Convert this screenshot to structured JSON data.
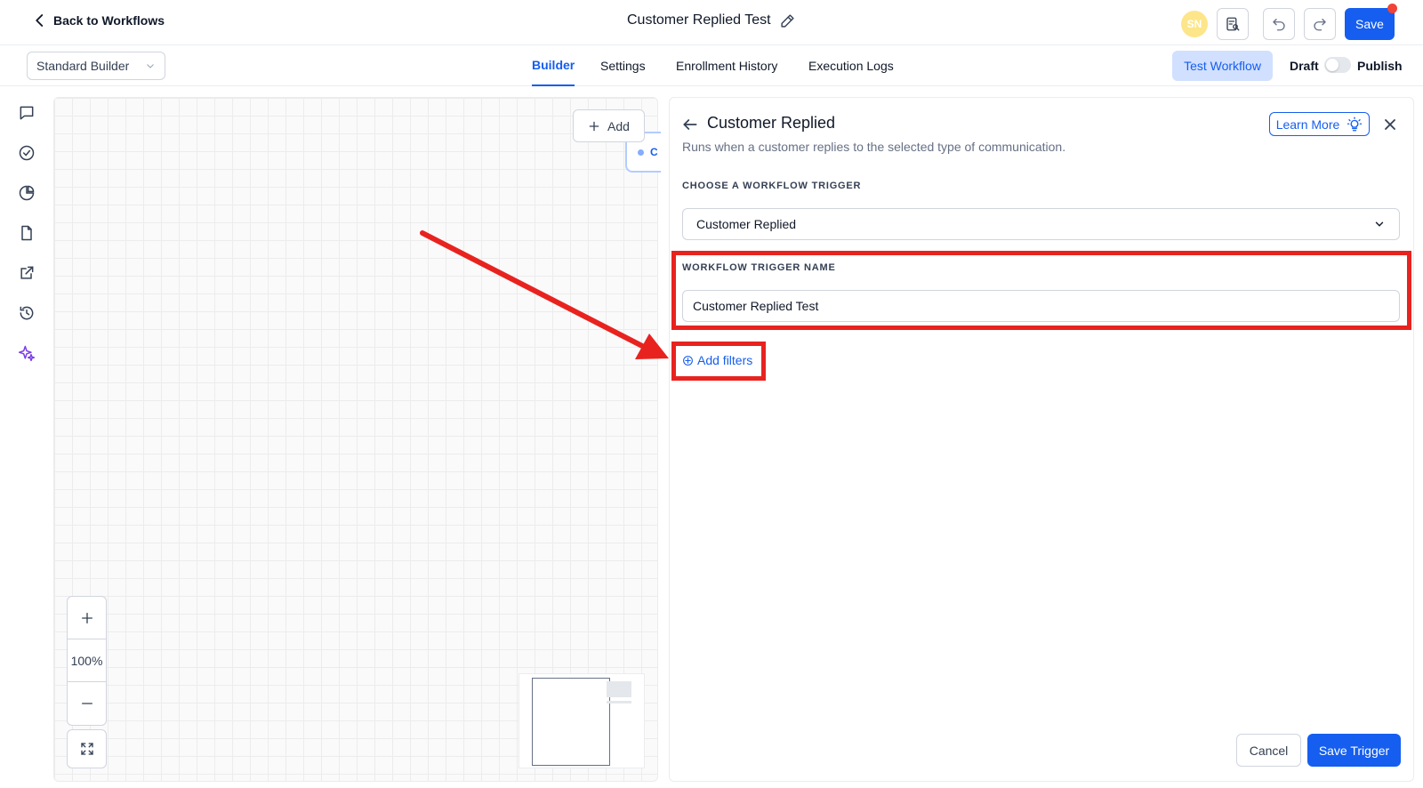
{
  "header": {
    "back_label": "Back to Workflows",
    "title": "Customer Replied Test",
    "avatar_initials": "SN",
    "save_label": "Save"
  },
  "subbar": {
    "builder_select": "Standard Builder",
    "tabs": [
      {
        "label": "Builder",
        "active": true
      },
      {
        "label": "Settings",
        "active": false
      },
      {
        "label": "Enrollment History",
        "active": false
      },
      {
        "label": "Execution Logs",
        "active": false
      }
    ],
    "test_workflow_label": "Test Workflow",
    "draft_label": "Draft",
    "publish_label": "Publish"
  },
  "sidebar": {
    "icons": [
      "message-icon",
      "check-circle-icon",
      "pie-chart-icon",
      "file-icon",
      "external-link-icon",
      "history-icon",
      "sparkle-icon"
    ]
  },
  "canvas": {
    "add_label": "Add",
    "node_peek_text": "C",
    "zoom_level": "100%"
  },
  "panel": {
    "title": "Customer Replied",
    "description": "Runs when a customer replies to the selected type of communication.",
    "learn_more_label": "Learn More",
    "trigger_label": "CHOOSE A WORKFLOW TRIGGER",
    "trigger_value": "Customer Replied",
    "name_label": "WORKFLOW TRIGGER NAME",
    "name_value": "Customer Replied Test",
    "add_filters_label": "Add filters",
    "cancel_label": "Cancel",
    "save_trigger_label": "Save Trigger"
  },
  "colors": {
    "primary": "#155eef",
    "annotation_red": "#e8231f",
    "notification_dot": "#f04438",
    "avatar_bg": "#fde68a"
  }
}
